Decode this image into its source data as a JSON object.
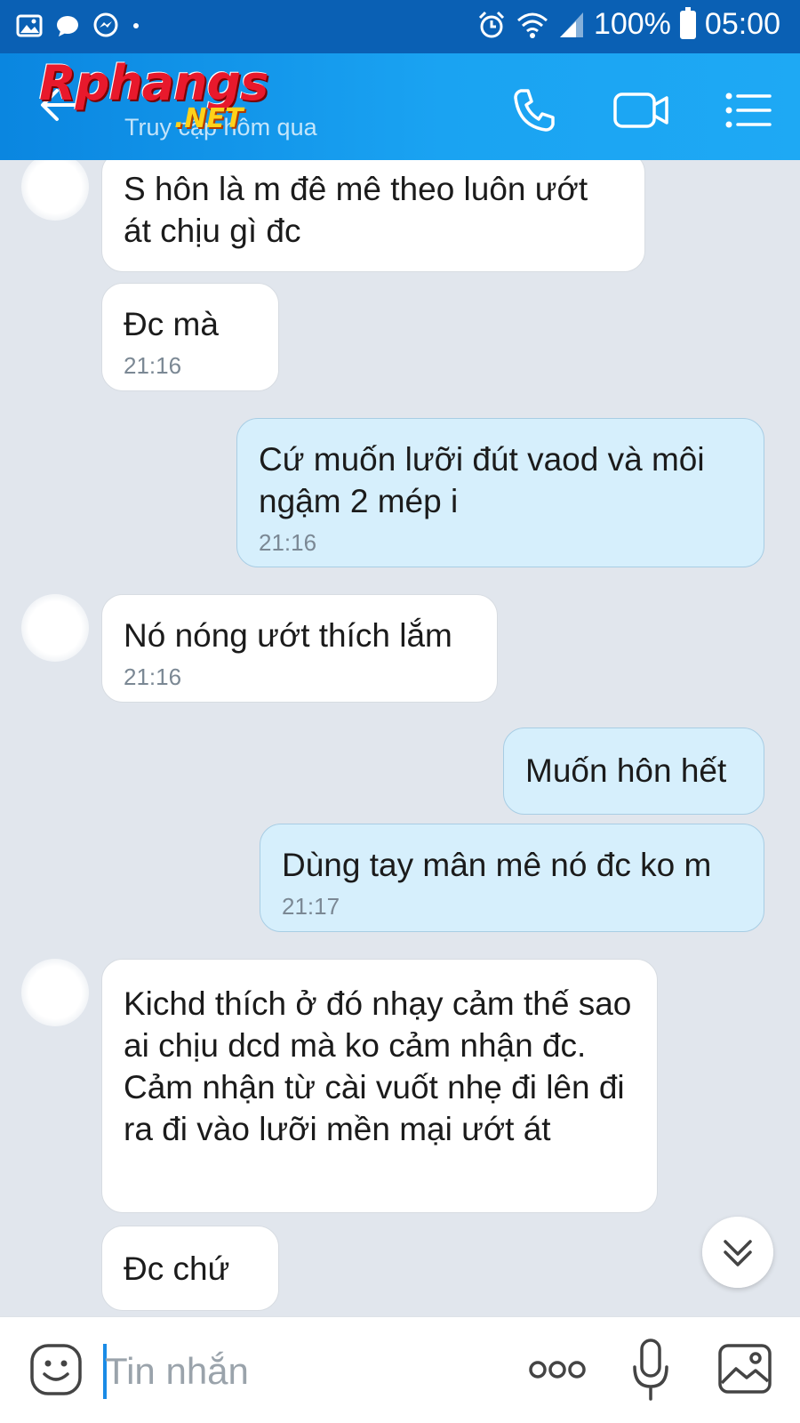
{
  "status_bar": {
    "battery": "100%",
    "time": "05:00"
  },
  "header": {
    "logo_main": "Rphangs",
    "logo_sub": ".NET",
    "last_seen": "Truy cập hôm qua"
  },
  "messages": [
    {
      "side": "in",
      "text": "S hôn là m đê mê theo luôn ướt át chịu gì đc",
      "time": ""
    },
    {
      "side": "in",
      "text": "Đc mà",
      "time": "21:16"
    },
    {
      "side": "out",
      "text": "Cứ muốn lưỡi đút vaod và môi ngậm 2 mép i",
      "time": "21:16"
    },
    {
      "side": "in",
      "text": "Nó nóng ướt thích lắm",
      "time": "21:16"
    },
    {
      "side": "out",
      "text": "Muốn hôn hết",
      "time": ""
    },
    {
      "side": "out",
      "text": "Dùng tay mân mê nó đc ko m",
      "time": "21:17"
    },
    {
      "side": "in",
      "text": "Kichd thích ở đó nhạy cảm thế sao ai chịu dcd mà ko cảm nhận đc. Cảm nhận từ cài vuốt nhẹ đi lên đi ra đi vào lưỡi mền mại ướt át",
      "time": ""
    },
    {
      "side": "in",
      "text": "Đc chứ",
      "time": ""
    }
  ],
  "input": {
    "placeholder": "Tin nhắn"
  },
  "icons": {
    "back": "arrow-left-icon",
    "call": "phone-icon",
    "video": "video-camera-icon",
    "menu": "list-menu-icon",
    "emoji": "emoji-icon",
    "more": "more-dots-icon",
    "mic": "microphone-icon",
    "gallery": "image-icon",
    "scroll": "double-chevron-down-icon"
  },
  "colors": {
    "header": "#1aa3f2",
    "status_bar": "#0a60b4",
    "outgoing_bubble": "#d6effc",
    "incoming_bubble": "#ffffff",
    "background": "#e1e6ed"
  }
}
